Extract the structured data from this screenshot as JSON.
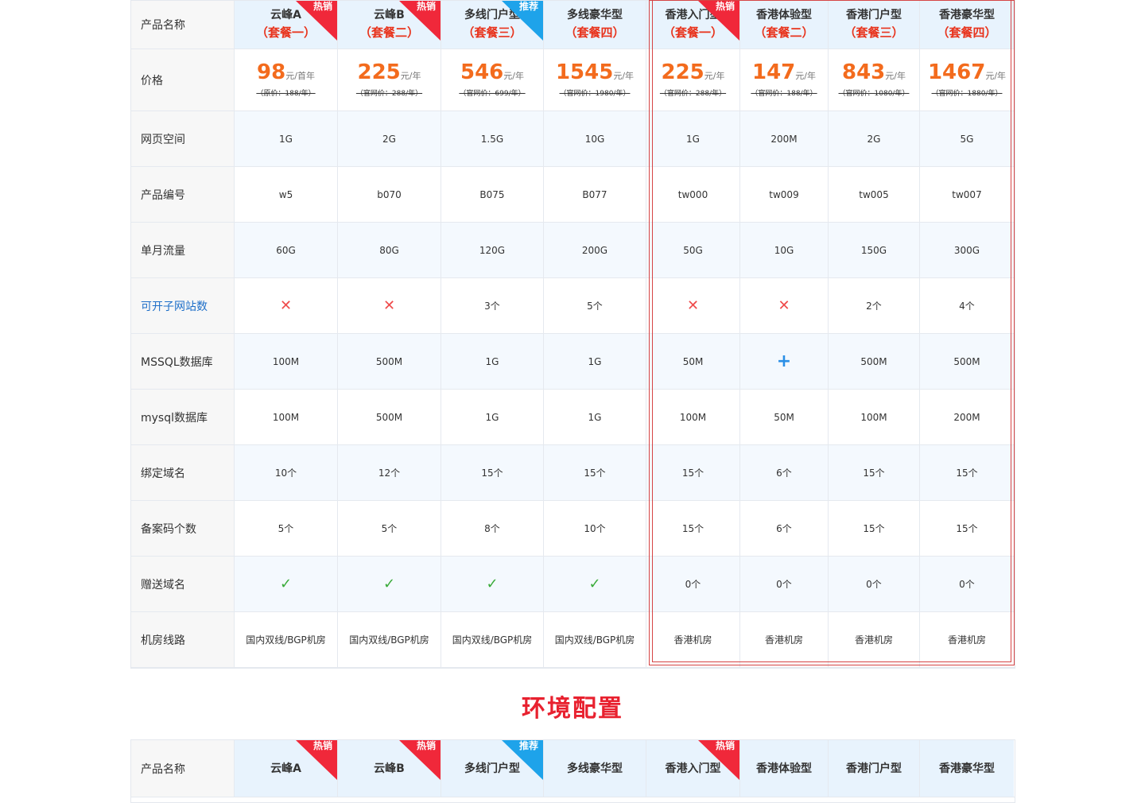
{
  "labels": {
    "product_name": "产品名称",
    "price": "价格",
    "web_space": "网页空间",
    "product_code": "产品编号",
    "monthly_traffic": "单月流量",
    "subsites": "可开子网站数",
    "mssql": "MSSQL数据库",
    "mysql": "mysql数据库",
    "bind_domains": "绑定域名",
    "icp_codes": "备案码个数",
    "gift_domain": "赠送域名",
    "datacenter": "机房线路"
  },
  "products": [
    {
      "name": "云峰A",
      "package": "（套餐一）",
      "badge": "热销",
      "badge_color": "red",
      "price": "98",
      "unit": "元/首年",
      "orig": "（原价：188/年）",
      "space": "1G",
      "code": "w5",
      "traffic": "60G",
      "subsites": "x",
      "mssql": "100M",
      "mysql": "100M",
      "domains": "10个",
      "icp": "5个",
      "gift": "check",
      "dc": "国内双线/BGP机房"
    },
    {
      "name": "云峰B",
      "package": "（套餐二）",
      "badge": "热销",
      "badge_color": "red",
      "price": "225",
      "unit": "元/年",
      "orig": "（官网价：288/年）",
      "space": "2G",
      "code": "b070",
      "traffic": "80G",
      "subsites": "x",
      "mssql": "500M",
      "mysql": "500M",
      "domains": "12个",
      "icp": "5个",
      "gift": "check",
      "dc": "国内双线/BGP机房"
    },
    {
      "name": "多线门户型",
      "package": "（套餐三）",
      "badge": "推荐",
      "badge_color": "blue",
      "price": "546",
      "unit": "元/年",
      "orig": "（官网价：699/年）",
      "space": "1.5G",
      "code": "B075",
      "traffic": "120G",
      "subsites": "3个",
      "mssql": "1G",
      "mysql": "1G",
      "domains": "15个",
      "icp": "8个",
      "gift": "check",
      "dc": "国内双线/BGP机房"
    },
    {
      "name": "多线豪华型",
      "package": "（套餐四）",
      "badge": "",
      "badge_color": "",
      "price": "1545",
      "unit": "元/年",
      "orig": "（官网价：1980/年）",
      "space": "10G",
      "code": "B077",
      "traffic": "200G",
      "subsites": "5个",
      "mssql": "1G",
      "mysql": "1G",
      "domains": "15个",
      "icp": "10个",
      "gift": "check",
      "dc": "国内双线/BGP机房"
    },
    {
      "name": "香港入门型",
      "package": "（套餐一）",
      "badge": "热销",
      "badge_color": "red",
      "price": "225",
      "unit": "元/年",
      "orig": "（官网价：288/年）",
      "space": "1G",
      "code": "tw000",
      "traffic": "50G",
      "subsites": "x",
      "mssql": "50M",
      "mysql": "100M",
      "domains": "15个",
      "icp": "15个",
      "gift": "0个",
      "dc": "香港机房"
    },
    {
      "name": "香港体验型",
      "package": "（套餐二）",
      "badge": "",
      "badge_color": "",
      "price": "147",
      "unit": "元/年",
      "orig": "（官网价：188/年）",
      "space": "200M",
      "code": "tw009",
      "traffic": "10G",
      "subsites": "x",
      "mssql": "plus",
      "mysql": "50M",
      "domains": "6个",
      "icp": "6个",
      "gift": "0个",
      "dc": "香港机房"
    },
    {
      "name": "香港门户型",
      "package": "（套餐三）",
      "badge": "",
      "badge_color": "",
      "price": "843",
      "unit": "元/年",
      "orig": "（官网价：1080/年）",
      "space": "2G",
      "code": "tw005",
      "traffic": "150G",
      "subsites": "2个",
      "mssql": "500M",
      "mysql": "100M",
      "domains": "15个",
      "icp": "15个",
      "gift": "0个",
      "dc": "香港机房"
    },
    {
      "name": "香港豪华型",
      "package": "（套餐四）",
      "badge": "",
      "badge_color": "",
      "price": "1467",
      "unit": "元/年",
      "orig": "（官网价：1880/年）",
      "space": "5G",
      "code": "tw007",
      "traffic": "300G",
      "subsites": "4个",
      "mssql": "500M",
      "mysql": "200M",
      "domains": "15个",
      "icp": "15个",
      "gift": "0个",
      "dc": "香港机房"
    }
  ],
  "section2": {
    "title": "环境配置",
    "label": "产品名称"
  },
  "glyphs": {
    "x": "✕",
    "check": "✓",
    "plus": "+"
  }
}
